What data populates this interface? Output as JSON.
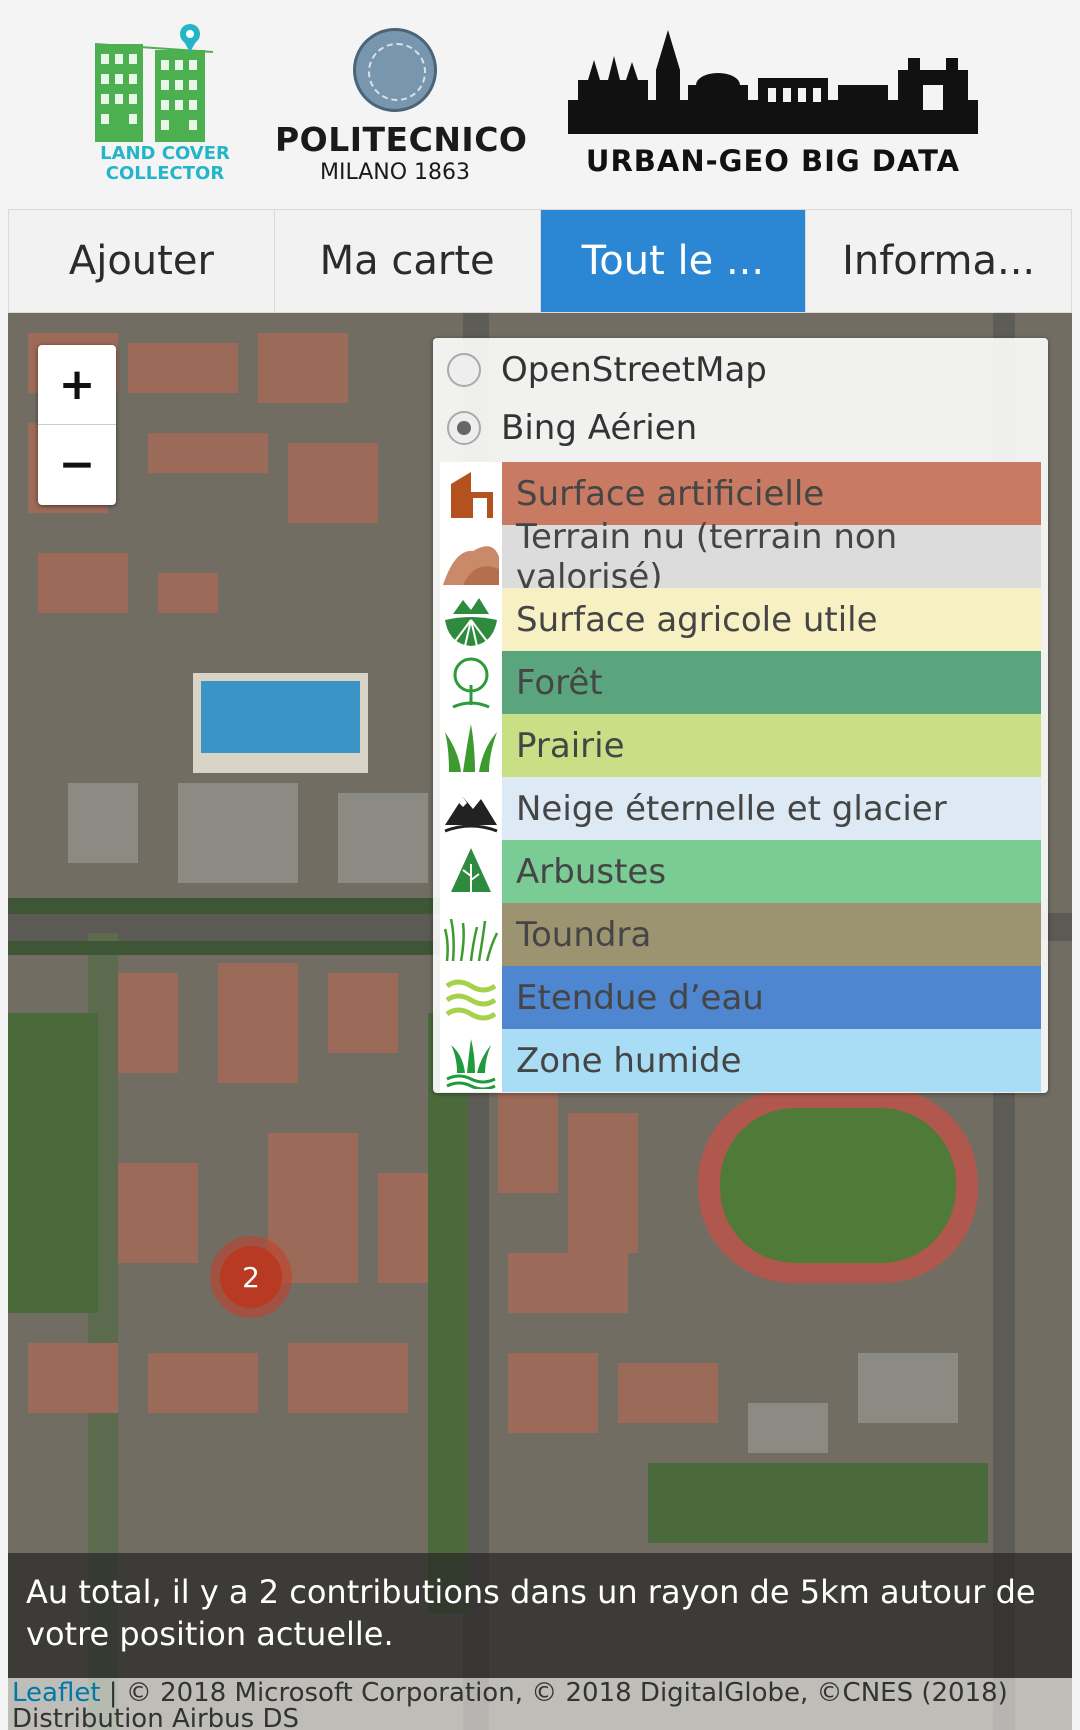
{
  "header": {
    "lcc_logo": {
      "line1": "LAND COVER",
      "line2": "COLLECTOR"
    },
    "polimi_logo": {
      "name": "POLITECNICO",
      "sub": "MILANO 1863"
    },
    "ugbd_logo": {
      "text": "URBAN-GEO BIG DATA"
    }
  },
  "tabs": [
    {
      "label": "Ajouter"
    },
    {
      "label": "Ma carte"
    },
    {
      "label": "Tout le ...",
      "active": true
    },
    {
      "label": "Informa..."
    }
  ],
  "map": {
    "zoom_in": "+",
    "zoom_out": "−",
    "base_layers": [
      {
        "label": "OpenStreetMap",
        "checked": false
      },
      {
        "label": "Bing Aérien",
        "checked": true
      }
    ],
    "legend": [
      {
        "label": "Surface artificielle",
        "color": "#c87a62",
        "icon": "building-icon"
      },
      {
        "label": "Terrain nu (terrain non valorisé)",
        "color": "#dcdcdc",
        "icon": "bare-hill-icon"
      },
      {
        "label": "Surface agricole utile",
        "color": "#f6f0c2",
        "icon": "field-icon"
      },
      {
        "label": "Forêt",
        "color": "#5aa47e",
        "icon": "tree-icon"
      },
      {
        "label": "Prairie",
        "color": "#c9df86",
        "icon": "grass-icon"
      },
      {
        "label": "Neige éternelle et glacier",
        "color": "#dde9f4",
        "icon": "mountain-icon"
      },
      {
        "label": "Arbustes",
        "color": "#7acb94",
        "icon": "shrub-icon"
      },
      {
        "label": "Toundra",
        "color": "#9c9470",
        "icon": "tundra-icon"
      },
      {
        "label": "Etendue d’eau",
        "color": "#4f86d0",
        "icon": "water-icon"
      },
      {
        "label": "Zone humide",
        "color": "#a9dcf5",
        "icon": "wetland-icon"
      }
    ],
    "cluster_count": "2",
    "info_text": "Au total, il y a 2 contributions dans un rayon de 5km autour de votre position actuelle.",
    "attribution": {
      "leaflet": "Leaflet",
      "text": " | © 2018 Microsoft Corporation, © 2018 DigitalGlobe, ©CNES (2018) Distribution Airbus DS"
    }
  }
}
